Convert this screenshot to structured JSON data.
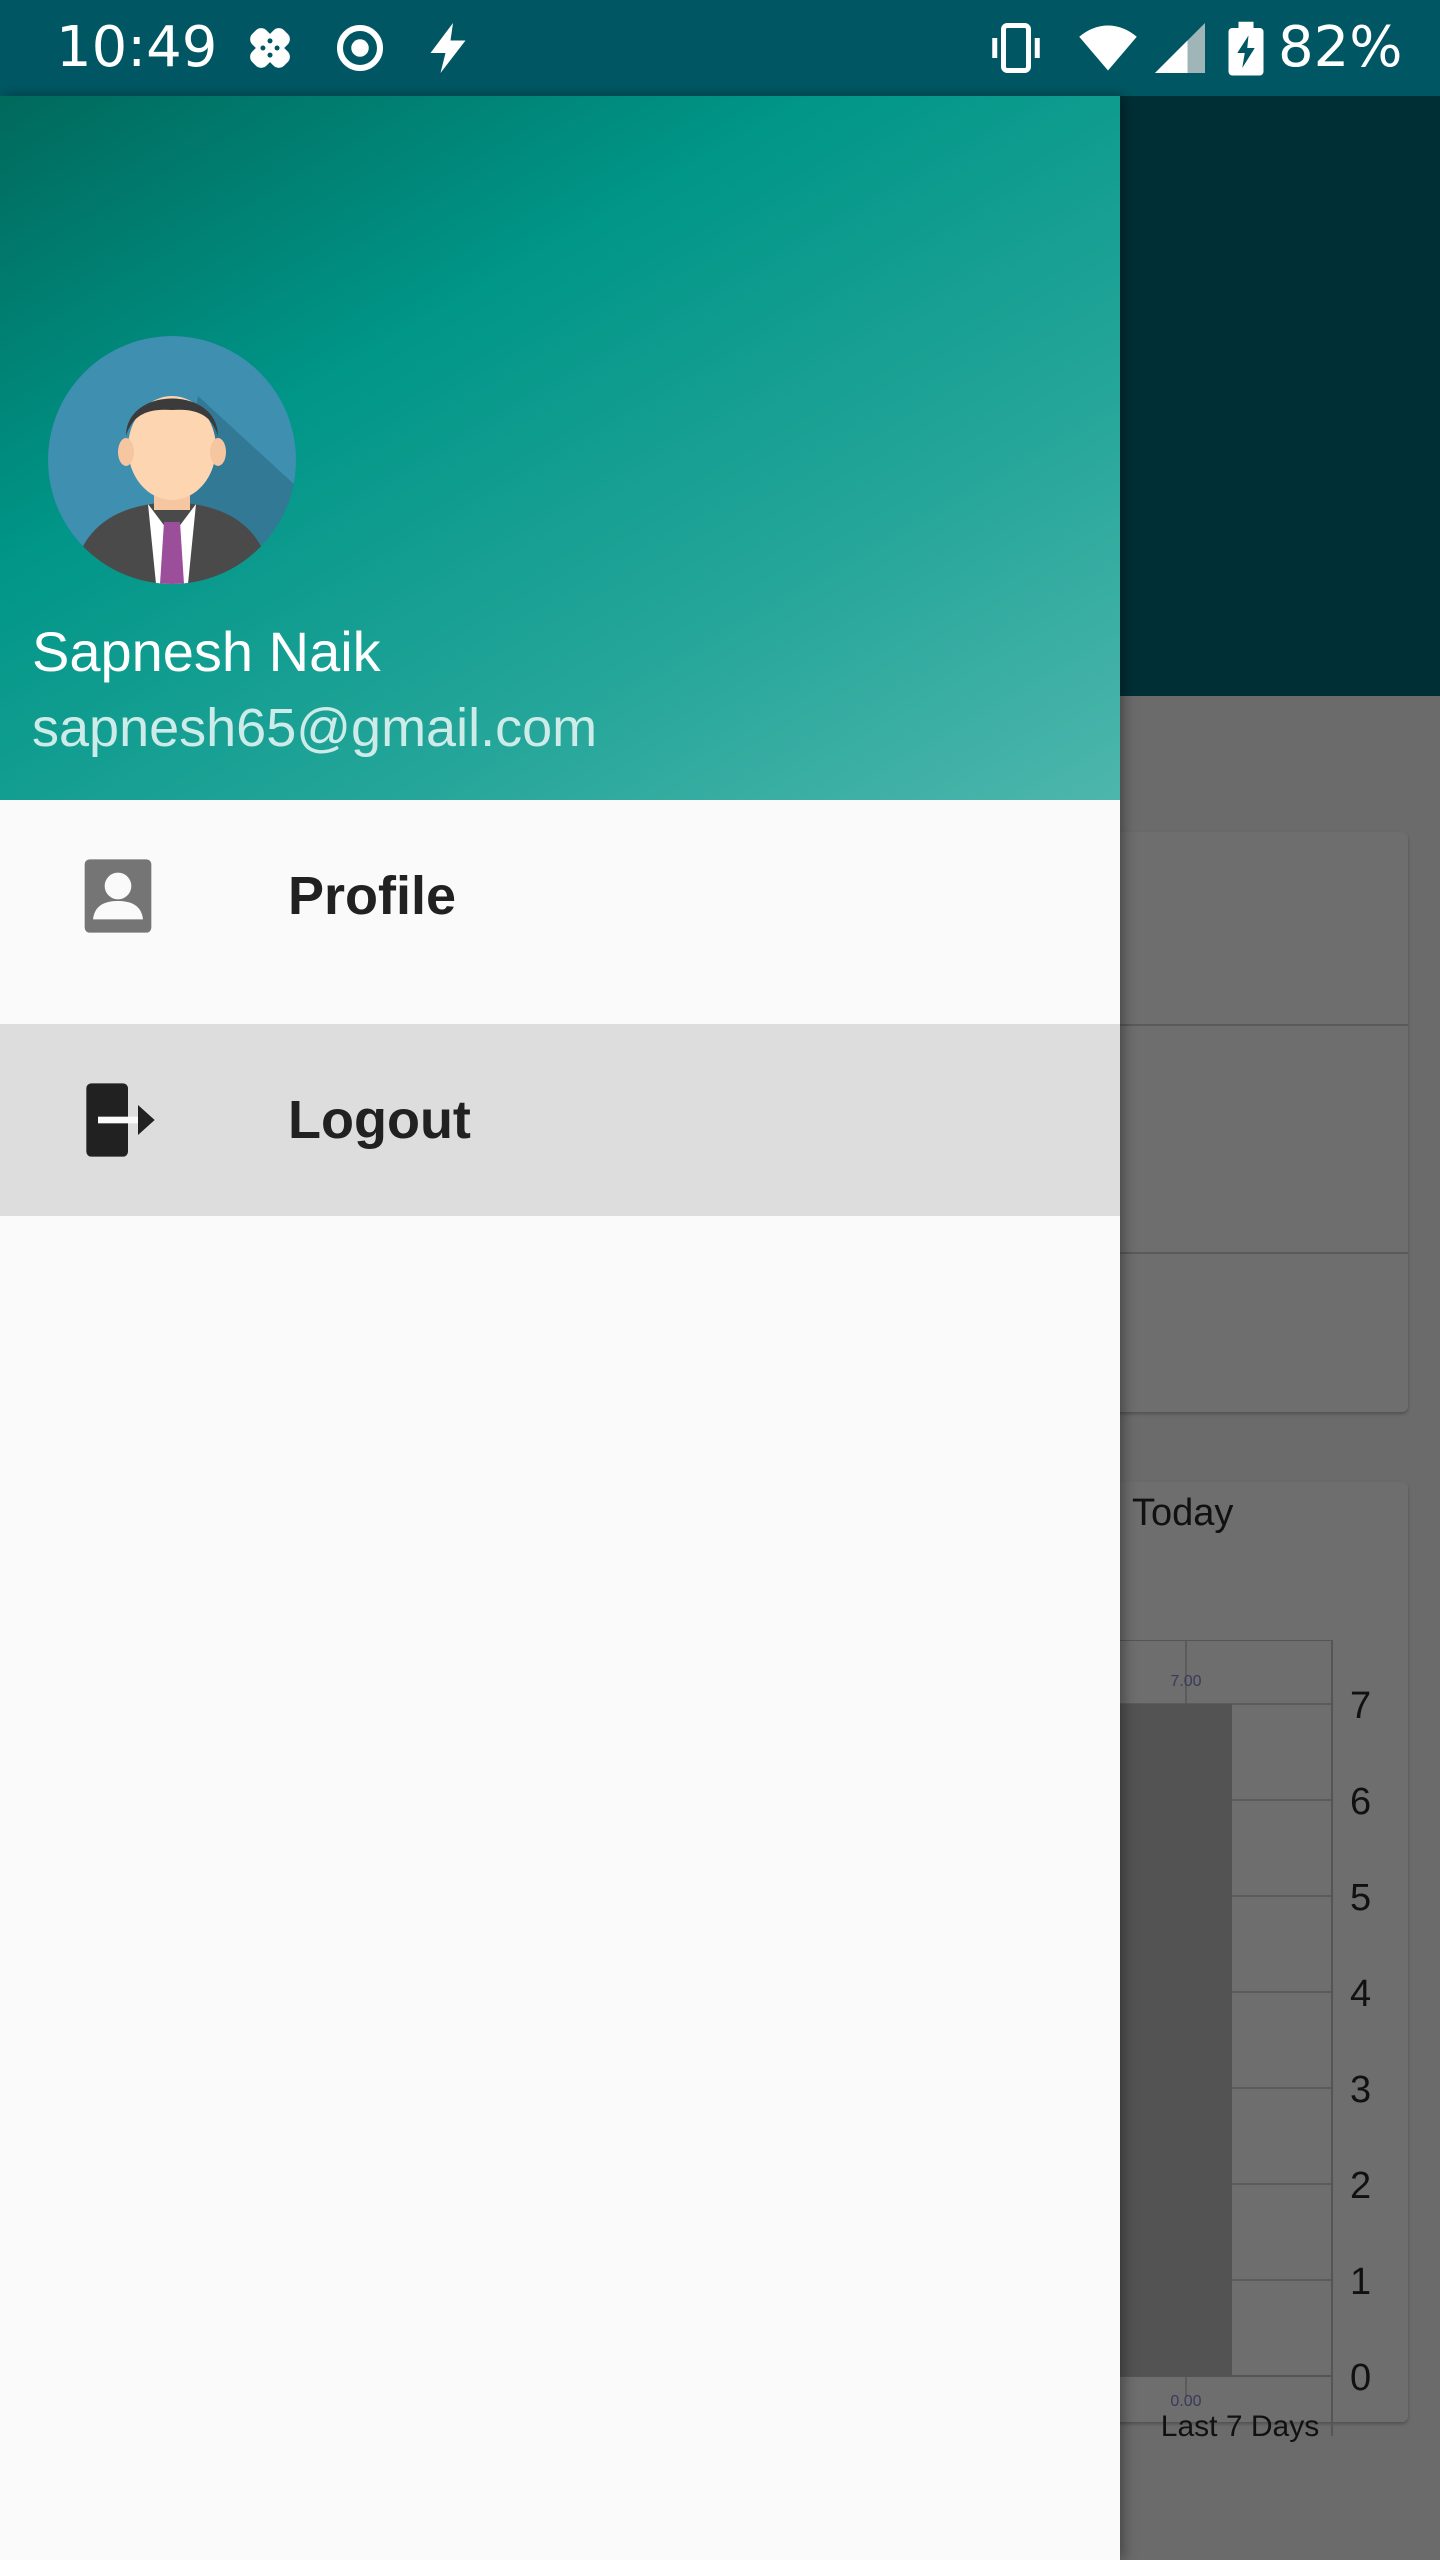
{
  "status_bar": {
    "time": "10:49",
    "battery": "82%",
    "icons": [
      "photo-icon",
      "radio-icon",
      "flash-icon",
      "vibrate-icon",
      "wifi-icon",
      "cell-signal-icon",
      "battery-charging-icon"
    ]
  },
  "drawer": {
    "user_name": "Sapnesh Naik",
    "user_email": "sapnesh65@gmail.com",
    "items": [
      {
        "label": "Profile",
        "icon": "account-box-icon"
      },
      {
        "label": "Logout",
        "icon": "logout-icon"
      }
    ]
  },
  "background": {
    "chart_title": "Today",
    "chart_data": {
      "type": "bar",
      "categories": [
        "0.00"
      ],
      "series": [
        {
          "values": [
            7.0
          ]
        }
      ],
      "bar_value_label": "7.00",
      "xlabel": "Last 7 Days",
      "ylabel": "",
      "ylim": [
        0,
        7
      ],
      "y_ticks": [
        "7",
        "6",
        "5",
        "4",
        "3",
        "2",
        "1",
        "0"
      ],
      "grid": true
    }
  },
  "colors": {
    "status_bar": "#005763",
    "drawer_header_start": "#00695c",
    "drawer_header_end": "#4db6ac",
    "selected_item": "#dddddd",
    "toolbar_dim": "#002f36"
  }
}
